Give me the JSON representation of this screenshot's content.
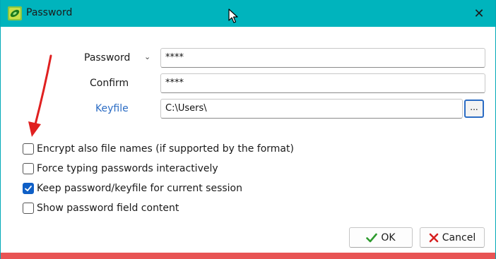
{
  "window": {
    "title": "Password",
    "close_glyph": "✕"
  },
  "form": {
    "password_label": "Password",
    "password_value": "****",
    "confirm_label": "Confirm",
    "confirm_value": "****",
    "keyfile_label": "Keyfile",
    "keyfile_value": "C:\\Users\\",
    "browse_label": "...",
    "dropdown_glyph": "⌄"
  },
  "options": [
    {
      "label": "Encrypt also file names (if supported by the format)",
      "checked": false
    },
    {
      "label": "Force typing passwords interactively",
      "checked": false
    },
    {
      "label": "Keep password/keyfile for current session",
      "checked": true
    },
    {
      "label": "Show password field content",
      "checked": false
    }
  ],
  "buttons": {
    "ok_label": "OK",
    "cancel_label": "Cancel"
  },
  "colors": {
    "titlebar": "#00b4bd",
    "accent": "#0f5fc6",
    "link": "#2b6cc4",
    "annotation_arrow": "#e02020",
    "bottom_bar": "#e85454"
  },
  "icons": [
    "app-icon",
    "close-icon",
    "mouse-cursor-icon",
    "checkmark-icon",
    "ok-check-icon",
    "cancel-x-icon",
    "annotation-arrow"
  ]
}
